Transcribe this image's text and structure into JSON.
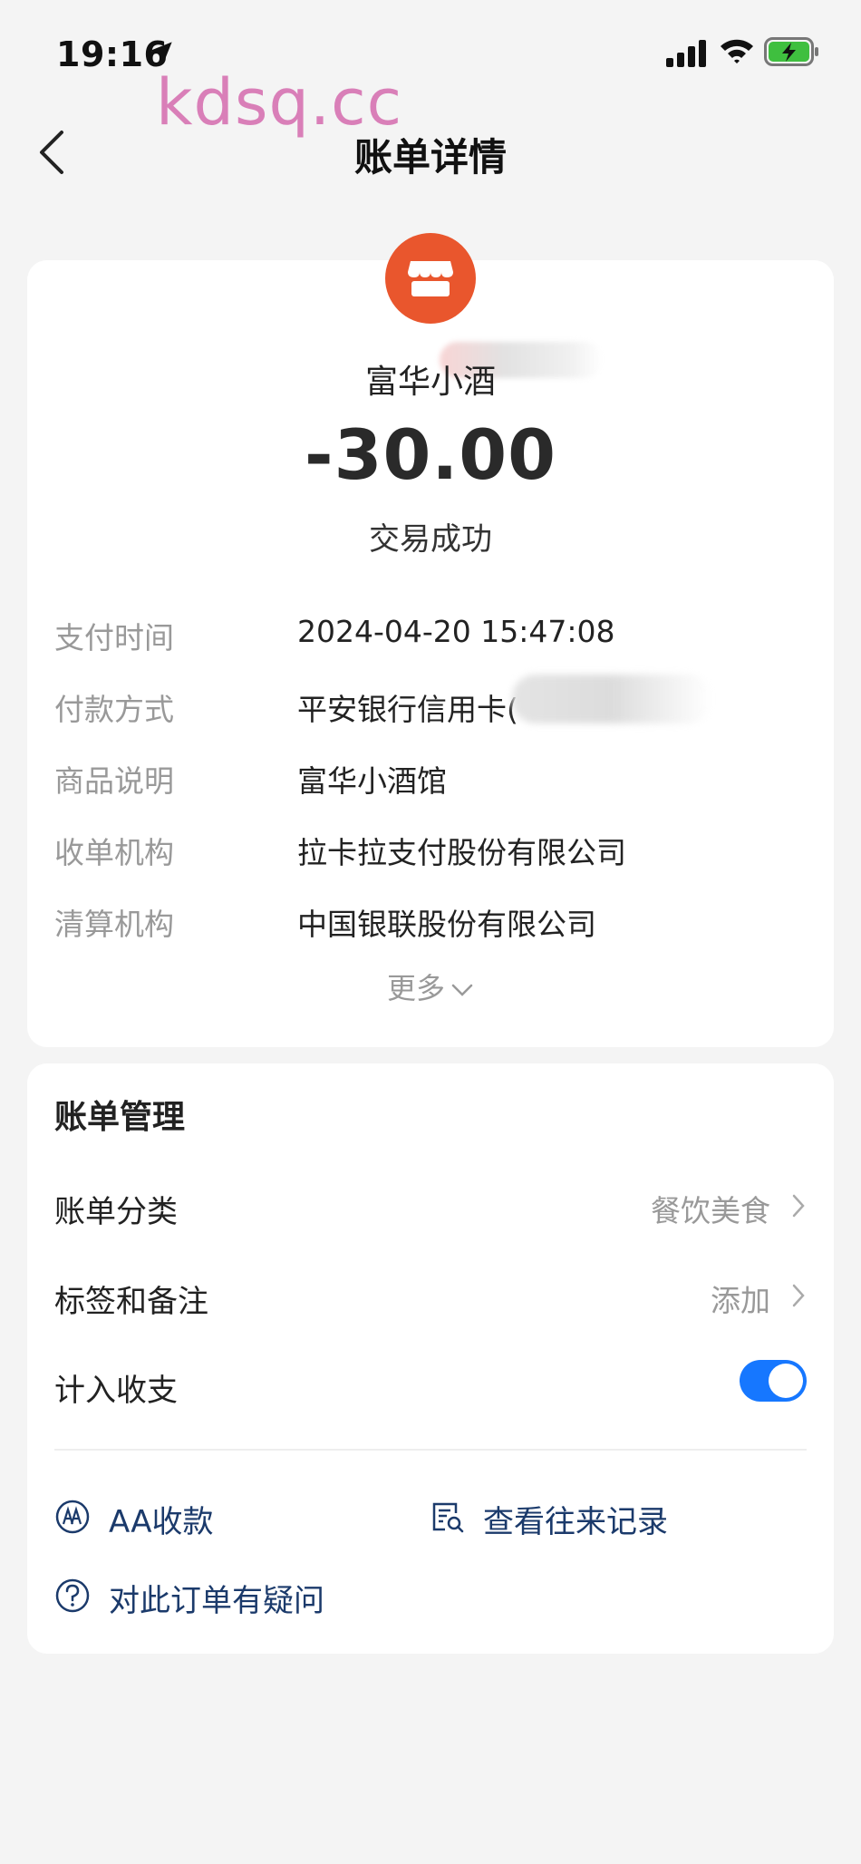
{
  "status_bar": {
    "time": "19:16",
    "icons": [
      "location-arrow-icon",
      "cellular-signal-icon",
      "wifi-icon",
      "battery-charging-icon"
    ],
    "battery_color": "#3fbf3f"
  },
  "watermark": "kdsq.cc",
  "header": {
    "title": "账单详情",
    "back_icon": "chevron-left-icon"
  },
  "transaction": {
    "merchant_icon": "store-icon",
    "merchant_icon_color": "#e9562d",
    "merchant_name": "富华小酒",
    "amount": "-30.00",
    "status": "交易成功",
    "details": [
      {
        "label": "支付时间",
        "value": "2024-04-20 15:47:08"
      },
      {
        "label": "付款方式",
        "value": "平安银行信用卡("
      },
      {
        "label": "商品说明",
        "value": "富华小酒馆"
      },
      {
        "label": "收单机构",
        "value": "拉卡拉支付股份有限公司"
      },
      {
        "label": "清算机构",
        "value": "中国银联股份有限公司"
      }
    ],
    "more_label": "更多"
  },
  "bill_management": {
    "title": "账单管理",
    "rows": [
      {
        "label": "账单分类",
        "value": "餐饮美食"
      },
      {
        "label": "标签和备注",
        "value": "添加"
      },
      {
        "label": "计入收支",
        "toggle_on": true
      }
    ],
    "actions": [
      {
        "label": "AA收款",
        "icon": "aa-icon"
      },
      {
        "label": "查看往来记录",
        "icon": "records-search-icon"
      },
      {
        "label": "对此订单有疑问",
        "icon": "question-circle-icon"
      }
    ],
    "accent_color": "#1677ff",
    "action_color": "#1b3a6b"
  }
}
